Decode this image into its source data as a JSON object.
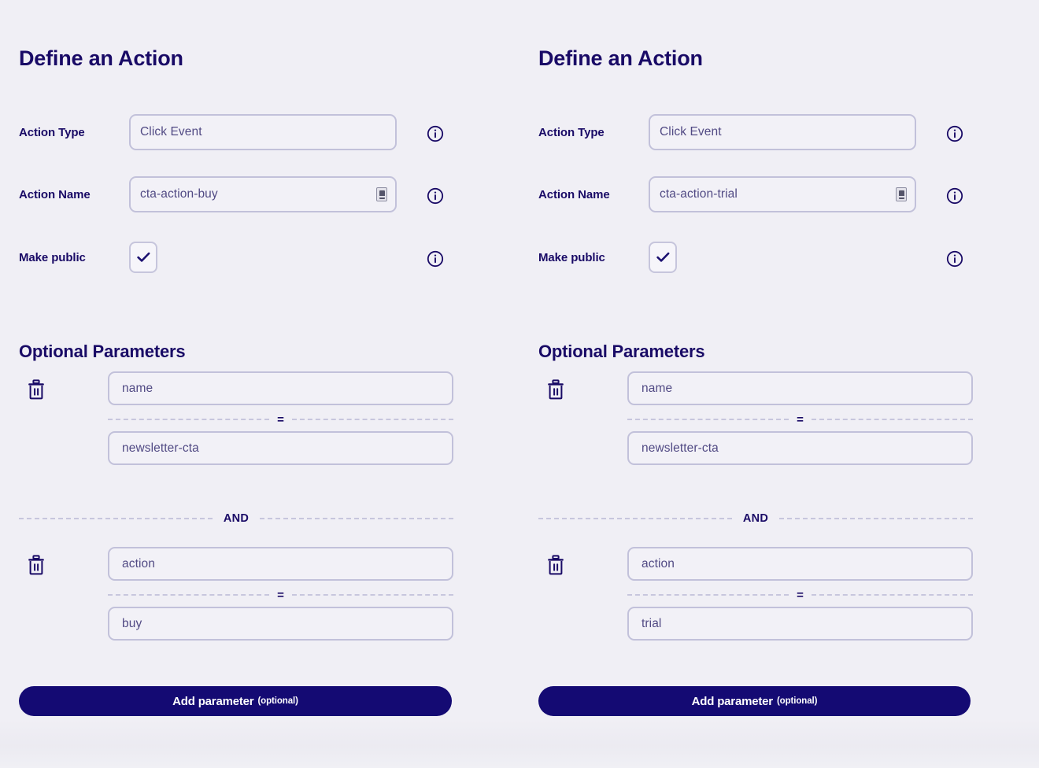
{
  "theme": {
    "background": "#f0eff5",
    "navy": "#190a66",
    "button_bg": "#140a73",
    "input_border": "#c2c1da",
    "input_bg": "#f2f1f7",
    "value_text": "#514a84",
    "divider": "#c7c6dd"
  },
  "panels": [
    {
      "title": "Define an Action",
      "fields": [
        {
          "label": "Action Type",
          "value": "Click Event",
          "has_copy_icon": false
        },
        {
          "label": "Action Name",
          "value": "cta-action-buy",
          "has_copy_icon": true
        }
      ],
      "checkbox": {
        "label": "Make public",
        "checked": true,
        "mark": "✔"
      },
      "parameters_heading": "Optional Parameters",
      "and_label": "AND",
      "eq_label": "=",
      "parameters": [
        {
          "key": "name",
          "value": "newsletter-cta"
        },
        {
          "key": "action",
          "value": "buy"
        }
      ],
      "add_button": {
        "main": "Add parameter",
        "optional": "(optional)"
      }
    },
    {
      "title": "Define an Action",
      "fields": [
        {
          "label": "Action Type",
          "value": "Click Event",
          "has_copy_icon": false
        },
        {
          "label": "Action Name",
          "value": "cta-action-trial",
          "has_copy_icon": true
        }
      ],
      "checkbox": {
        "label": "Make public",
        "checked": true,
        "mark": "✔"
      },
      "parameters_heading": "Optional Parameters",
      "and_label": "AND",
      "eq_label": "=",
      "parameters": [
        {
          "key": "name",
          "value": "newsletter-cta"
        },
        {
          "key": "action",
          "value": "trial"
        }
      ],
      "add_button": {
        "main": "Add parameter",
        "optional": "(optional)"
      }
    }
  ],
  "icons": {
    "info": "info-icon",
    "trash": "trash-icon",
    "copy": "clipboard-icon",
    "check": "check-icon"
  }
}
